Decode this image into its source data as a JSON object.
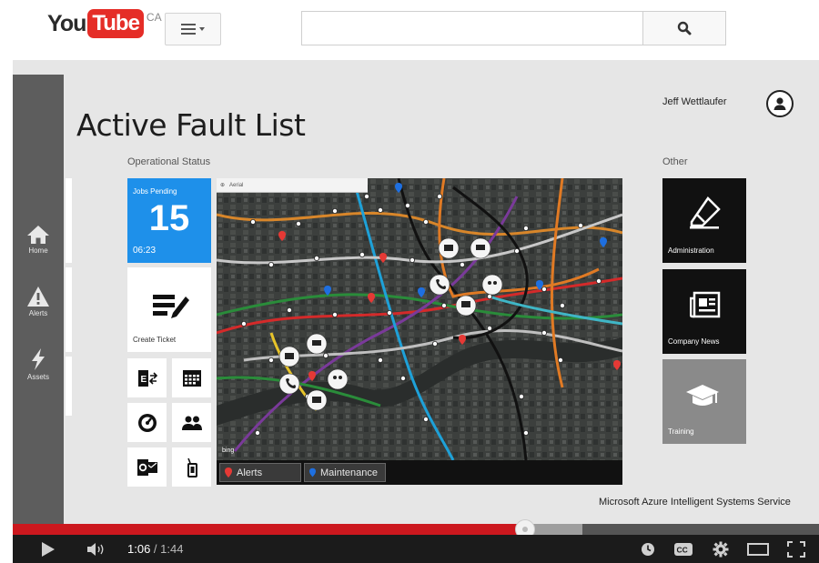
{
  "youtube": {
    "logo_you": "You",
    "logo_tube": "Tube",
    "region": "CA",
    "search_value": "",
    "icons": {
      "guide": "menu-icon",
      "search": "search-icon"
    }
  },
  "app": {
    "title": "Active Fault List",
    "user_name": "Jeff Wettlaufer",
    "sidebar": [
      {
        "label": "Home",
        "icon": "home-icon"
      },
      {
        "label": "Alerts",
        "icon": "warning-icon"
      },
      {
        "label": "Assets",
        "icon": "lightning-icon"
      }
    ],
    "operational_status_label": "Operational Status",
    "jobs_tile": {
      "label": "Jobs Pending",
      "count": "15",
      "time": "06:23",
      "color": "#1e90ea"
    },
    "create_ticket_label": "Create Ticket",
    "mini_tiles": [
      "exchange-icon",
      "calendar-icon",
      "gauge-icon",
      "people-icon",
      "outlook-icon",
      "badge-icon"
    ],
    "map": {
      "toolbar_text": "Aerial",
      "legend": [
        {
          "label": "Alerts",
          "color": "#e53935"
        },
        {
          "label": "Maintenance",
          "color": "#1e6fe0"
        }
      ],
      "bing_label": "bing"
    },
    "other_label": "Other",
    "other_tiles": [
      {
        "label": "Administration",
        "icon": "pencil-eraser-icon"
      },
      {
        "label": "Company News",
        "icon": "newspaper-icon"
      },
      {
        "label": "Training",
        "icon": "graduation-cap-icon"
      }
    ],
    "caption": "Microsoft Azure Intelligent Systems Service"
  },
  "player": {
    "current_time": "1:06",
    "separator": " / ",
    "duration": "1:44",
    "progress_fraction": 0.636,
    "buffered_fraction": 0.707,
    "accent": "#cc181e"
  }
}
